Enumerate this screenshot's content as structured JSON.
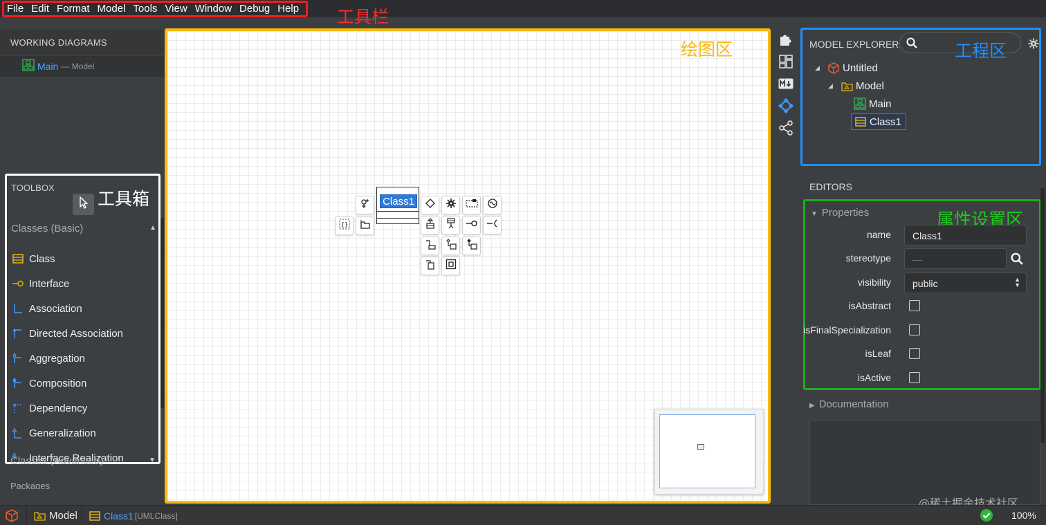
{
  "menubar": {
    "items": [
      "File",
      "Edit",
      "Format",
      "Model",
      "Tools",
      "View",
      "Window",
      "Debug",
      "Help"
    ]
  },
  "annotations": {
    "toolbar": "工具栏",
    "toolbox": "工具箱",
    "canvas": "绘图区",
    "project": "工程区",
    "properties": "属性设置区"
  },
  "working_diagrams": {
    "title": "WORKING DIAGRAMS",
    "item_name": "Main",
    "item_sub": "— Model"
  },
  "toolbox": {
    "title": "TOOLBOX",
    "section_basic": "Classes (Basic)",
    "items": [
      "Class",
      "Interface",
      "Association",
      "Directed Association",
      "Aggregation",
      "Composition",
      "Dependency",
      "Generalization",
      "Interface Realization"
    ],
    "section_advanced": "Classes (Advanced)",
    "section_packages": "Packages"
  },
  "canvas": {
    "class_name": "Class1"
  },
  "explorer": {
    "title": "MODEL EXPLORER",
    "tree": {
      "root": "Untitled",
      "model": "Model",
      "diagram": "Main",
      "class": "Class1"
    }
  },
  "editors": {
    "title": "EDITORS",
    "properties_title": "Properties",
    "labels": {
      "name": "name",
      "stereotype": "stereotype",
      "visibility": "visibility",
      "isAbstract": "isAbstract",
      "isFinalSpecialization": "isFinalSpecialization",
      "isLeaf": "isLeaf",
      "isActive": "isActive"
    },
    "values": {
      "name": "Class1",
      "stereotype": "—",
      "visibility": "public"
    },
    "documentation_title": "Documentation"
  },
  "statusbar": {
    "model": "Model",
    "class": "Class1",
    "class_type": "[UMLClass]",
    "zoom": "100%"
  },
  "watermark": "@稀土掘金技术社区",
  "colors": {
    "menu_border": "#ff1a1a",
    "canvas_border": "#f7b910",
    "explorer_border": "#1e8fff",
    "properties_border": "#1fad1f",
    "toolbox_border": "#ffffff",
    "accent": "#2f7bd9"
  }
}
